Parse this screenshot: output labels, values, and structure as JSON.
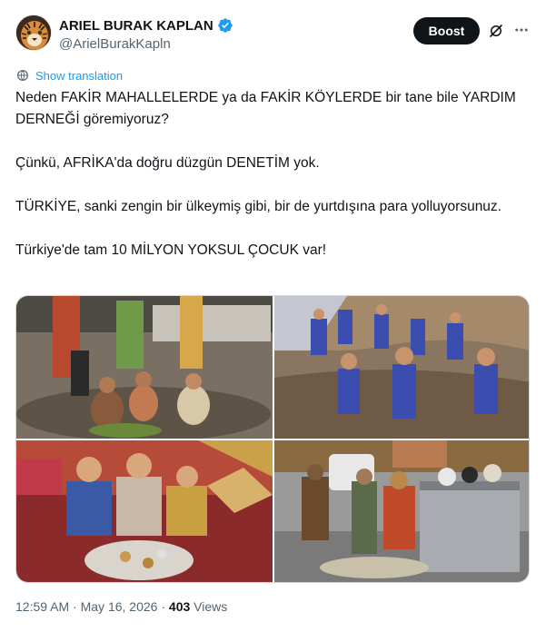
{
  "author": {
    "name": "ARIEL BURAK KAPLAN",
    "handle": "@ArielBurakKapln",
    "avatar_icon": "tiger-avatar",
    "verified_icon": "verified-badge-icon",
    "verified_color": "#1d9bf0"
  },
  "actions": {
    "boost_label": "Boost",
    "grok_icon": "grok-icon",
    "more_icon": "more-icon"
  },
  "translation": {
    "label": "Show translation",
    "icon": "translate-icon"
  },
  "tweet": {
    "line1": "Neden FAKİR MAHALLELERDE ya da FAKİR KÖYLERDE bir tane bile YARDIM DERNEĞİ göremiyoruz?",
    "line2": "Çünkü, AFRİKA'da doğru düzgün DENETİM yok.",
    "line3": "TÜRKİYE, sanki zengin bir ülkeymiş gibi, bir de yurtdışına para yolluyorsunuz.",
    "line4": "Türkiye'de tam 10 MİLYON YOKSUL ÇOCUK var!"
  },
  "footer": {
    "time": "12:59 AM",
    "separator": " · ",
    "date": "May 16, 2026",
    "views_count": "403",
    "views_label": " Views"
  },
  "colors": {
    "text": "#0f1419",
    "secondary": "#536471",
    "accent": "#1d9bf0",
    "button_bg": "#0f1419"
  }
}
